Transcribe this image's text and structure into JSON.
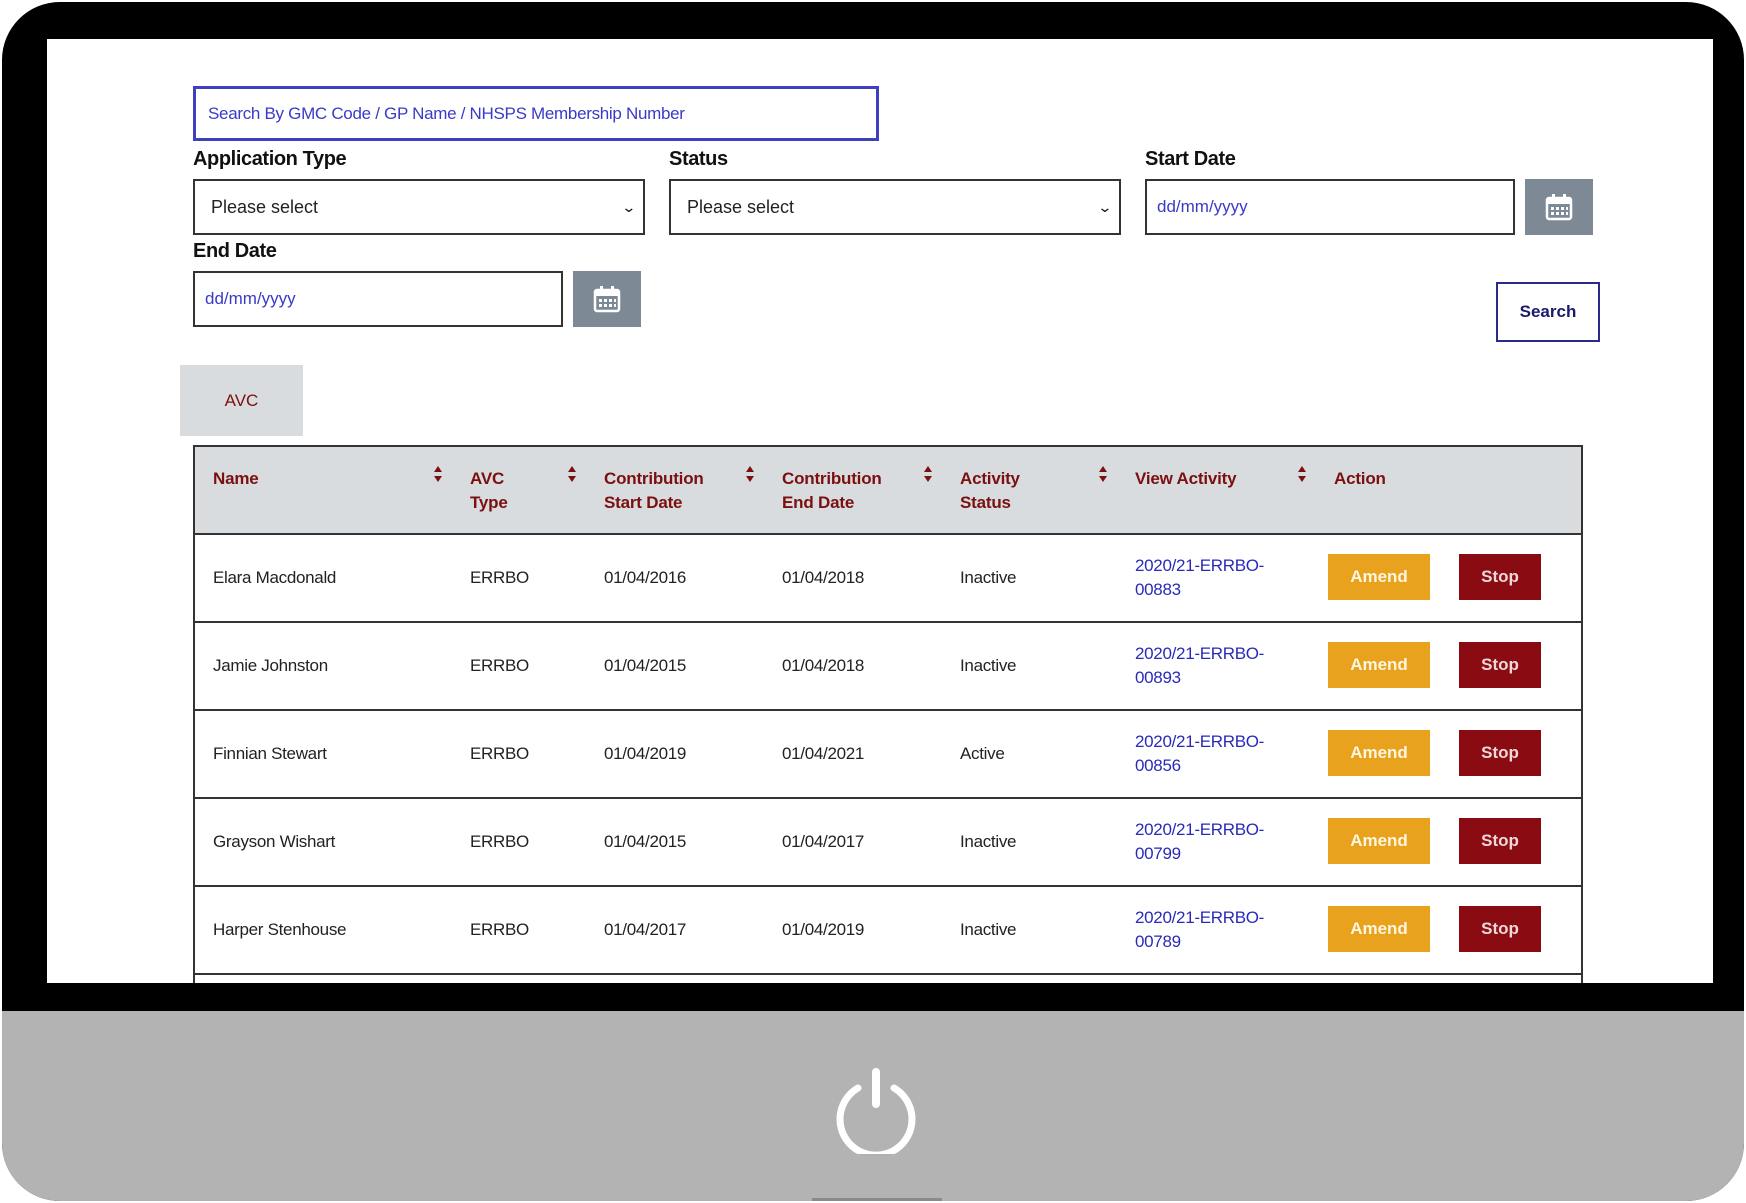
{
  "search": {
    "placeholder": "Search By GMC Code / GP Name / NHSPS Membership Number"
  },
  "filters": {
    "application_type_label": "Application Type",
    "application_type_value": "Please select",
    "status_label": "Status",
    "status_value": "Please select",
    "start_date_label": "Start Date",
    "start_date_placeholder": "dd/mm/yyyy",
    "end_date_label": "End Date",
    "end_date_placeholder": "dd/mm/yyyy",
    "search_button": "Search"
  },
  "tabs": {
    "active": "AVC"
  },
  "table": {
    "headers": {
      "name": "Name",
      "avc_type_1": "AVC",
      "avc_type_2": "Type",
      "contribution_start_1": "Contribution",
      "contribution_start_2": "Start Date",
      "contribution_end_1": "Contribution",
      "contribution_end_2": "End Date",
      "activity_status_1": "Activity",
      "activity_status_2": "Status",
      "view_activity": "View Activity",
      "action": "Action"
    },
    "rows": [
      {
        "name": "Elara Macdonald",
        "avc_type": "ERRBO",
        "start": "01/04/2016",
        "end": "01/04/2018",
        "status": "Inactive",
        "activity_1": "2020/21-ERRBO-",
        "activity_2": "00883",
        "amend": "Amend",
        "stop": "Stop"
      },
      {
        "name": "Jamie Johnston",
        "avc_type": "ERRBO",
        "start": "01/04/2015",
        "end": "01/04/2018",
        "status": "Inactive",
        "activity_1": "2020/21-ERRBO-",
        "activity_2": "00893",
        "amend": "Amend",
        "stop": "Stop"
      },
      {
        "name": "Finnian Stewart",
        "avc_type": "ERRBO",
        "start": "01/04/2019",
        "end": "01/04/2021",
        "status": "Active",
        "activity_1": "2020/21-ERRBO-",
        "activity_2": "00856",
        "amend": "Amend",
        "stop": "Stop"
      },
      {
        "name": "Grayson Wishart",
        "avc_type": "ERRBO",
        "start": "01/04/2015",
        "end": "01/04/2017",
        "status": "Inactive",
        "activity_1": "2020/21-ERRBO-",
        "activity_2": "00799",
        "amend": "Amend",
        "stop": "Stop"
      },
      {
        "name": "Harper Stenhouse",
        "avc_type": "ERRBO",
        "start": "01/04/2017",
        "end": "01/04/2019",
        "status": "Inactive",
        "activity_1": "2020/21-ERRBO-",
        "activity_2": "00789",
        "amend": "Amend",
        "stop": "Stop"
      }
    ]
  },
  "icons": {
    "calendar": "calendar-icon",
    "sort": "sort-icon",
    "chevron": "chevron-down-icon",
    "power": "power-icon"
  },
  "colors": {
    "header_bg": "#d9dcde",
    "header_text": "#7a1010",
    "amend": "#e8a21e",
    "stop": "#8b0b12",
    "link": "#2a2ab8",
    "bezel": "#000000",
    "chin": "#b3b3b3"
  }
}
